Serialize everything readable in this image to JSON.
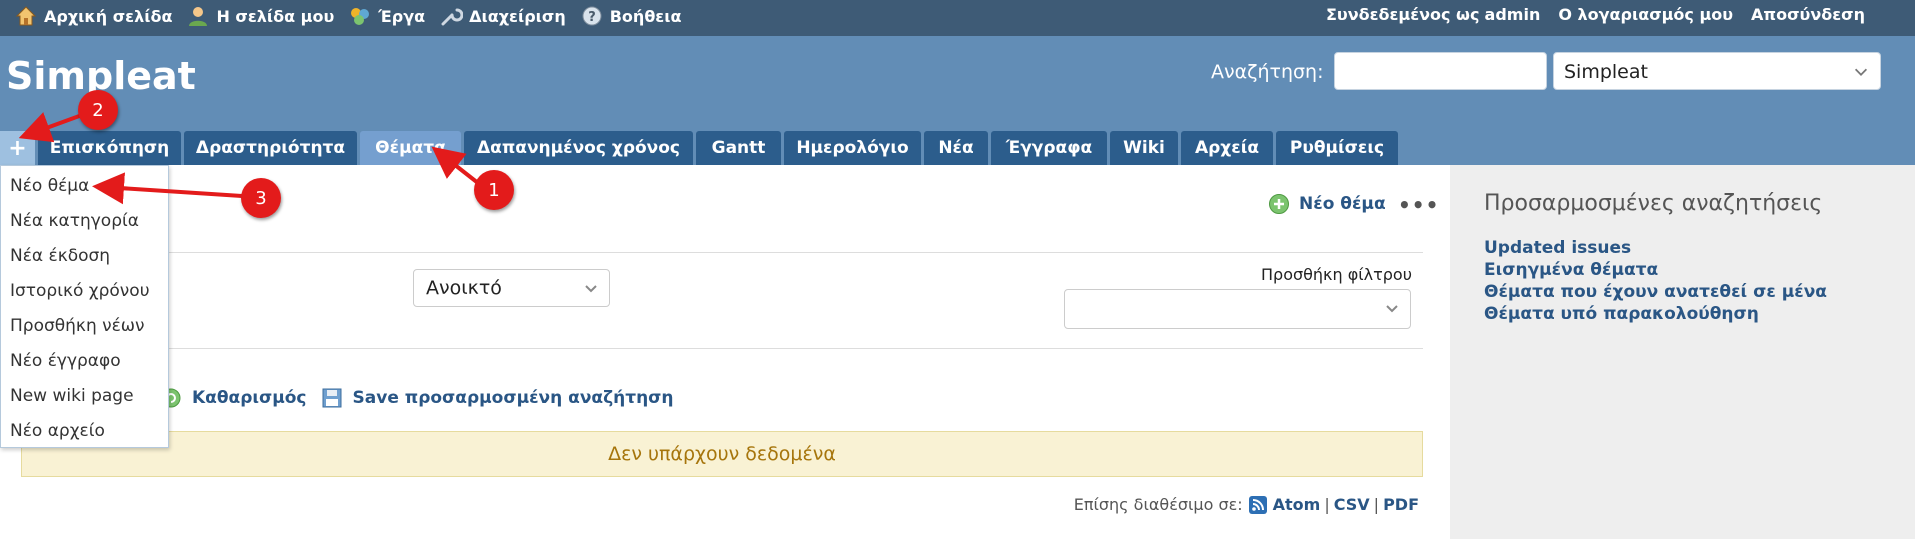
{
  "top_menu": {
    "items": [
      {
        "label": "Αρχική σελίδα",
        "icon": "home-icon"
      },
      {
        "label": "Η σελίδα μου",
        "icon": "user-icon"
      },
      {
        "label": "Έργα",
        "icon": "projects-icon"
      },
      {
        "label": "Διαχείριση",
        "icon": "wrench-icon"
      },
      {
        "label": "Βοήθεια",
        "icon": "help-icon"
      }
    ],
    "logged_prefix": "Συνδεδεμένος ως",
    "logged_user": "admin",
    "my_account": "Ο λογαριασμός μου",
    "logout": "Αποσύνδεση"
  },
  "header": {
    "project_title": "Simpleat",
    "search_label": "Αναζήτηση:",
    "search_value": "",
    "project_select": "Simpleat"
  },
  "main_menu": {
    "plus": "+",
    "tabs": [
      {
        "label": "Επισκόπηση"
      },
      {
        "label": "Δραστηριότητα"
      },
      {
        "label": "Θέματα"
      },
      {
        "label": "Δαπανημένος χρόνος"
      },
      {
        "label": "Gantt"
      },
      {
        "label": "Ημερολόγιο"
      },
      {
        "label": "Νέα"
      },
      {
        "label": "Έγγραφα"
      },
      {
        "label": "Wiki"
      },
      {
        "label": "Αρχεία"
      },
      {
        "label": "Ρυθμίσεις"
      }
    ],
    "selected": "Θέματα"
  },
  "new_object_menu": {
    "items": [
      "Νέο θέμα",
      "Νέα κατηγορία",
      "Νέα έκδοση",
      "Ιστορικό χρόνου",
      "Προσθήκη νέων",
      "Νέο έγγραφο",
      "New wiki page",
      "Νέο αρχείο"
    ]
  },
  "content": {
    "new_issue": "Νέο θέμα",
    "dots": "•••",
    "status_value": "Ανοικτό",
    "add_filter_label": "Προσθήκη φίλτρου",
    "clear": "Καθαρισμός",
    "save_query": "Save προσαρμοσμένη αναζήτηση",
    "no_data": "Δεν υπάρχουν δεδομένα",
    "also_available": "Επίσης διαθέσιμο σε:",
    "formats": [
      "Atom",
      "CSV",
      "PDF"
    ],
    "separator": "|"
  },
  "sidebar": {
    "title": "Προσαρμοσμένες αναζητήσεις",
    "queries": [
      "Updated issues",
      "Εισηγμένα θέματα",
      "Θέματα που έχουν ανατεθεί σε μένα",
      "Θέματα υπό παρακολούθηση"
    ]
  },
  "annotations": {
    "badges": [
      "1",
      "2",
      "3"
    ],
    "color": "#e31b1b"
  },
  "colors": {
    "top_bar": "#3e5b76",
    "header": "#628db6",
    "tab": "#2c5d8c",
    "tab_selected": "#759fcf",
    "link": "#2a5685"
  }
}
